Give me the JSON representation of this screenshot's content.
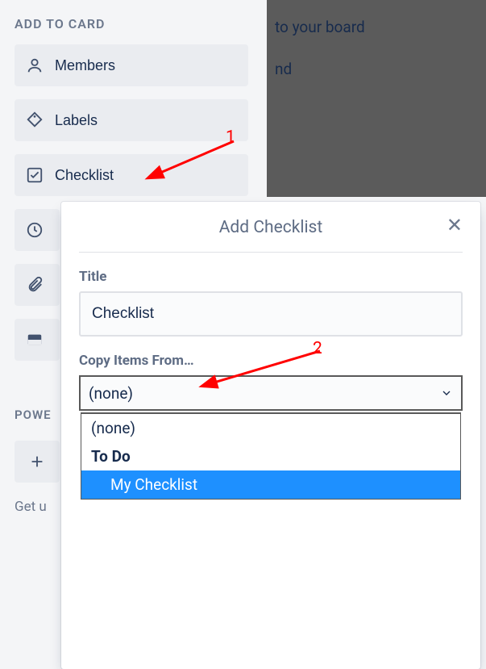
{
  "sidebar": {
    "heading": "ADD TO CARD",
    "items": [
      {
        "label": "Members"
      },
      {
        "label": "Labels"
      },
      {
        "label": "Checklist"
      }
    ]
  },
  "rightDark": {
    "line1": "to your board",
    "line2": "nd"
  },
  "popover": {
    "title": "Add Checklist",
    "titleLabel": "Title",
    "titleValue": "Checklist",
    "copyLabel": "Copy Items From…",
    "selectedValue": "(none)",
    "options": {
      "none": "(none)",
      "group": "To Do",
      "nested": "My Checklist"
    }
  },
  "powerups": {
    "heading": "POWE",
    "bottomText": "Get u"
  },
  "annotations": {
    "a1": "1",
    "a2": "2"
  }
}
